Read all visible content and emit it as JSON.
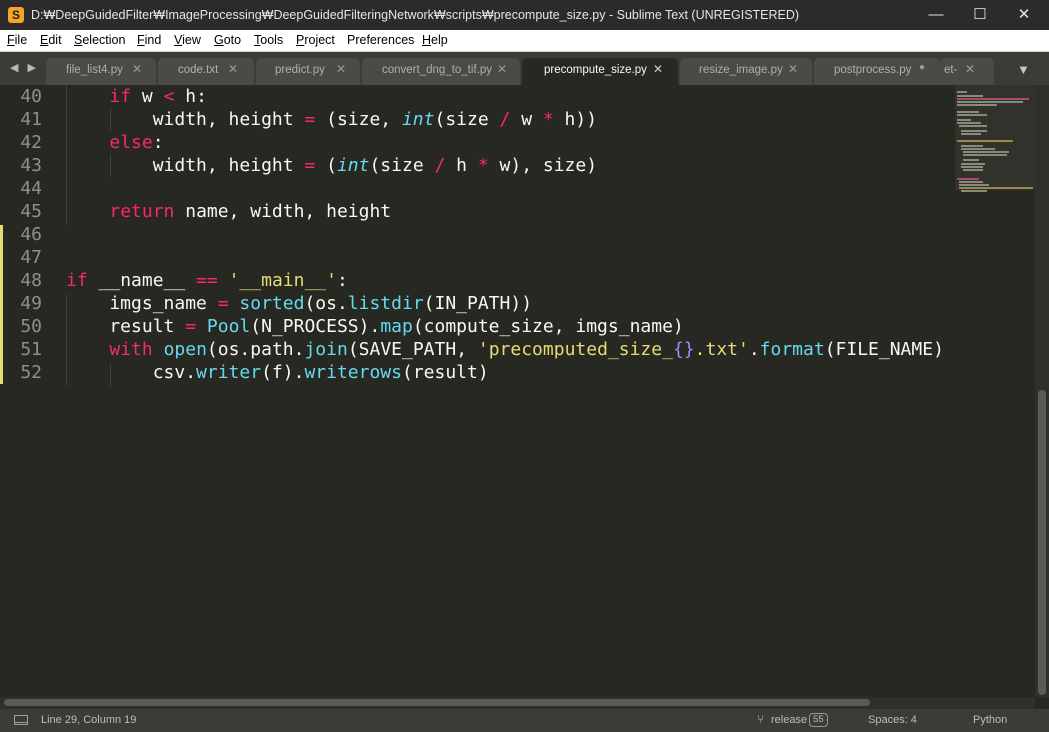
{
  "window": {
    "title": "D:₩DeepGuidedFilter₩ImageProcessing₩DeepGuidedFilteringNetwork₩scripts₩precompute_size.py - Sublime Text (UNREGISTERED)",
    "app_icon_letter": "S",
    "minimize_glyph": "—",
    "maximize_glyph": "☐",
    "close_glyph": "✕"
  },
  "menu": [
    {
      "acc": "F",
      "rest": "ile"
    },
    {
      "acc": "E",
      "rest": "dit"
    },
    {
      "acc": "S",
      "rest": "election"
    },
    {
      "acc": "F",
      "rest": "ind"
    },
    {
      "acc": "V",
      "rest": "iew"
    },
    {
      "acc": "G",
      "rest": "oto"
    },
    {
      "acc": "T",
      "rest": "ools"
    },
    {
      "acc": "P",
      "rest": "roject"
    },
    {
      "acc": "",
      "rest": "Preferences"
    },
    {
      "acc": "H",
      "rest": "elp"
    }
  ],
  "tabs": {
    "nav": "◀ ▶",
    "items": [
      {
        "label": "file_list4.py",
        "close": "✕"
      },
      {
        "label": "code.txt",
        "close": "✕"
      },
      {
        "label": "predict.py",
        "close": "✕"
      },
      {
        "label": "convert_dng_to_tif.py",
        "close": "✕"
      },
      {
        "label": "precompute_size.py",
        "close": "✕"
      },
      {
        "label": "resize_image.py",
        "close": "✕"
      },
      {
        "label": "postprocess.py",
        "close": "●"
      },
      {
        "label": "et-",
        "close": "✕"
      }
    ],
    "active_index": 4,
    "more": "▼"
  },
  "editor": {
    "line_numbers": [
      "40",
      "41",
      "42",
      "43",
      "44",
      "45",
      "46",
      "47",
      "48",
      "49",
      "50",
      "51",
      "52"
    ],
    "modified_lines": [
      "46",
      "47",
      "48",
      "49",
      "50",
      "51",
      "52"
    ]
  },
  "colors": {
    "background": "#272822",
    "keyword": "#f92672",
    "builtin": "#66d9ef",
    "string": "#e6db74",
    "placeholder": "#ae81ff",
    "text": "#f8f8f2"
  },
  "status": {
    "position": "Line 29, Column 19",
    "branch_icon": "branch-icon",
    "branch": "release",
    "branch_count": "55",
    "indentation": "Spaces: 4",
    "syntax": "Python"
  }
}
